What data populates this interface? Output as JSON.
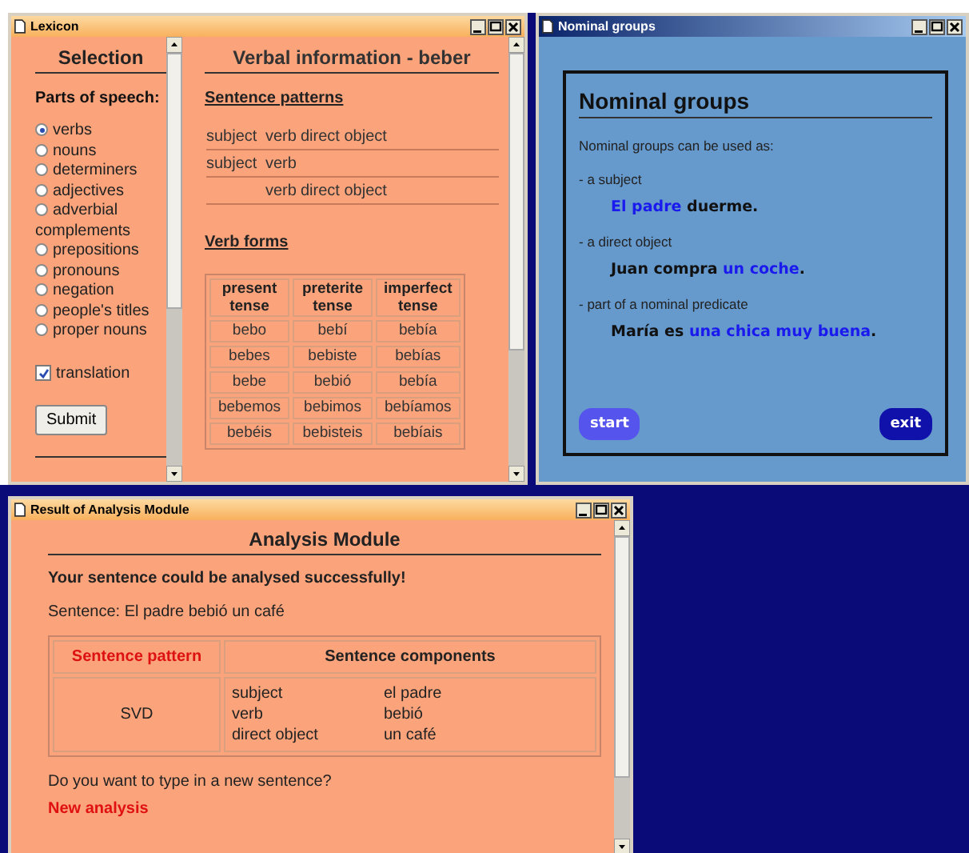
{
  "lexicon": {
    "title": "Lexicon",
    "selection_title": "Selection",
    "parts_label": "Parts of speech:",
    "radios": [
      {
        "label": "verbs",
        "selected": true
      },
      {
        "label": "nouns",
        "selected": false
      },
      {
        "label": "determiners",
        "selected": false
      },
      {
        "label": "adjectives",
        "selected": false
      },
      {
        "label": "adverbial complements",
        "selected": false
      },
      {
        "label": "prepositions",
        "selected": false
      },
      {
        "label": "pronouns",
        "selected": false
      },
      {
        "label": "negation",
        "selected": false
      },
      {
        "label": "people's titles",
        "selected": false
      },
      {
        "label": "proper nouns",
        "selected": false
      }
    ],
    "checkbox": {
      "label": "translation",
      "checked": true
    },
    "submit": "Submit",
    "verbal_title": "Verbal information - beber",
    "patterns_heading": "Sentence patterns",
    "patterns": [
      {
        "subject": "subject",
        "verb": "verb",
        "object": "direct object"
      },
      {
        "subject": "subject",
        "verb": "verb"
      },
      {
        "verb": "verb",
        "object": "direct object"
      }
    ],
    "forms_heading": "Verb forms",
    "forms_columns": [
      "present tense",
      "preterite tense",
      "imperfect tense"
    ],
    "forms_rows": [
      [
        "bebo",
        "bebí",
        "bebía"
      ],
      [
        "bebes",
        "bebiste",
        "bebías"
      ],
      [
        "bebe",
        "bebió",
        "bebía"
      ],
      [
        "bebemos",
        "bebimos",
        "bebíamos"
      ],
      [
        "bebéis",
        "bebisteis",
        "bebíais"
      ]
    ]
  },
  "nominal": {
    "title": "Nominal groups",
    "heading": "Nominal groups",
    "intro": "Nominal groups can be used as:",
    "uses": [
      {
        "label": "- a subject",
        "example": [
          {
            "text": "El padre",
            "highlight": true
          },
          {
            "text": "duerme.",
            "highlight": false
          }
        ]
      },
      {
        "label": "- a direct object",
        "example": [
          {
            "text": "Juan compra",
            "highlight": false
          },
          {
            "text": "un coche",
            "highlight": true
          },
          {
            "text": ".",
            "highlight": false
          }
        ]
      },
      {
        "label": "- part of a nominal predicate",
        "example": [
          {
            "text": "María es",
            "highlight": false
          },
          {
            "text": "una chica muy buena",
            "highlight": true
          },
          {
            "text": ".",
            "highlight": false
          }
        ]
      }
    ],
    "buttons": [
      {
        "label": "start",
        "kind": "start"
      },
      {
        "label": "exit",
        "kind": "exit"
      }
    ]
  },
  "result": {
    "title": "Result of Analysis Module",
    "heading": "Analysis Module",
    "success": "Your sentence could be analysed successfully!",
    "sentence": "Sentence: El padre bebió un café",
    "columns": [
      "Sentence pattern",
      "Sentence components"
    ],
    "pattern": "SVD",
    "components": [
      {
        "role": "subject",
        "word": "el padre"
      },
      {
        "role": "verb",
        "word": "bebió"
      },
      {
        "role": "direct object",
        "word": "un café"
      }
    ],
    "question": "Do you want to type in a new sentence?",
    "link": "New analysis"
  }
}
